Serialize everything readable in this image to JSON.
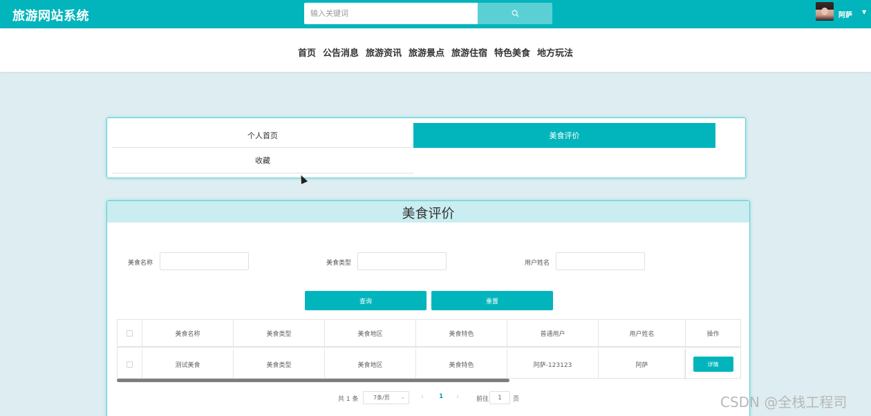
{
  "header": {
    "brand": "旅游网站系统",
    "search_placeholder": "输入关键词",
    "username": "阿萨"
  },
  "nav": [
    "首页",
    "公告消息",
    "旅游资讯",
    "旅游景点",
    "旅游住宿",
    "特色美食",
    "地方玩法"
  ],
  "tabs": {
    "personal": "个人首页",
    "active": "美食评价",
    "favorites": "收藏"
  },
  "main": {
    "title": "美食评价",
    "filters": {
      "food_name_label": "美食名称",
      "food_type_label": "美食类型",
      "user_name_label": "用户姓名"
    },
    "query_button": "查询",
    "reset_button": "重置"
  },
  "table": {
    "headers": [
      "美食名称",
      "美食类型",
      "美食地区",
      "美食特色",
      "普通用户",
      "用户姓名",
      "操作"
    ],
    "rows": [
      {
        "food_name": "测试美食",
        "food_type": "美食类型",
        "food_region": "美食地区",
        "food_feature": "美食特色",
        "user": "阿萨-123123",
        "user_name": "阿萨",
        "action": "详情"
      }
    ]
  },
  "pagination": {
    "total": "共 1 条",
    "page_size": "7条/页",
    "current_page": "1",
    "goto_prefix": "前往",
    "goto_value": "1",
    "goto_suffix": "页"
  },
  "watermark": "CSDN @全栈工程司",
  "colors": {
    "accent": "#02b5bc",
    "card_header_bg": "#c9edf0",
    "page_bg": "#deedf1"
  }
}
